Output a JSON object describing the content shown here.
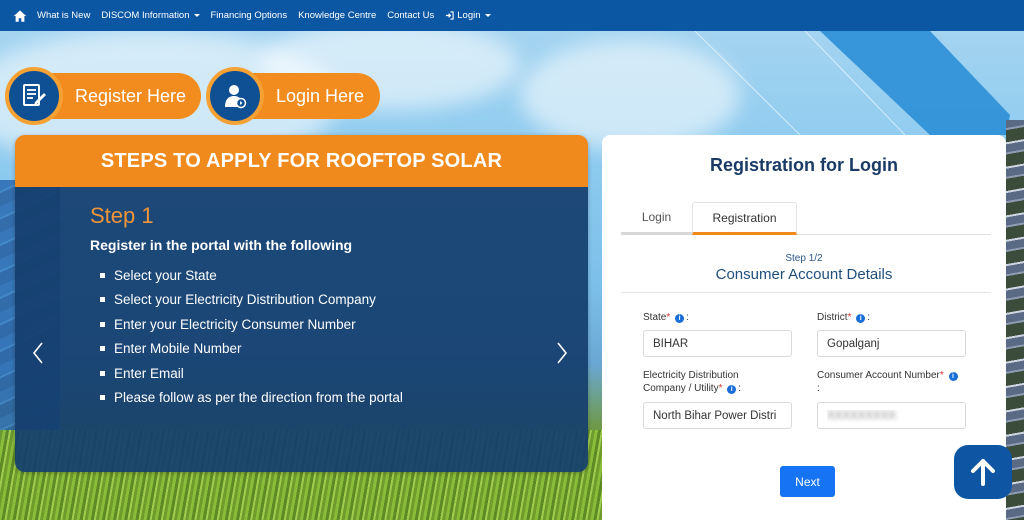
{
  "nav": {
    "home_icon": "home-icon",
    "items": [
      {
        "label": "What is New",
        "dropdown": false
      },
      {
        "label": "DISCOM Information",
        "dropdown": true
      },
      {
        "label": "Financing Options",
        "dropdown": false
      },
      {
        "label": "Knowledge Centre",
        "dropdown": false
      },
      {
        "label": "Contact Us",
        "dropdown": false
      },
      {
        "label": "Login",
        "dropdown": true,
        "icon": "sign-in-icon"
      }
    ]
  },
  "actions": {
    "register": {
      "label": "Register Here",
      "icon": "document-pen-icon"
    },
    "login": {
      "label": "Login Here",
      "icon": "user-arrow-icon"
    }
  },
  "steps": {
    "heading": "STEPS TO APPLY FOR ROOFTOP SOLAR",
    "title": "Step 1",
    "subtitle": "Register in the portal with the following",
    "items": [
      "Select your State",
      "Select your Electricity Distribution Company",
      "Enter your Electricity Consumer Number",
      "Enter Mobile Number",
      "Enter Email",
      "Please follow as per the direction from the portal"
    ],
    "prev_icon": "chevron-left-icon",
    "next_icon": "chevron-right-icon",
    "slide_count": 6,
    "active_slide": 1
  },
  "registration": {
    "title": "Registration for Login",
    "tabs": [
      {
        "label": "Login",
        "active": false
      },
      {
        "label": "Registration",
        "active": true
      }
    ],
    "step_indicator": "Step 1/2",
    "section_title": "Consumer Account Details",
    "fields": {
      "state": {
        "label": "State",
        "required_mark": "*",
        "suffix": ":",
        "value": "BIHAR"
      },
      "district": {
        "label": "District",
        "required_mark": "*",
        "suffix": ":",
        "value": "Gopalganj"
      },
      "utility": {
        "label_line1": "Electricity Distribution",
        "label_line2": "Company / Utility",
        "required_mark": "*",
        "suffix": ":",
        "value": "North Bihar Power Distri"
      },
      "account": {
        "label": "Consumer Account Number",
        "required_mark": "*",
        "suffix": ":",
        "value": "XXXXXXXXX"
      }
    },
    "info_glyph": "i",
    "next_label": "Next"
  },
  "scroll_top": {
    "icon": "arrow-up-icon"
  },
  "colors": {
    "nav_bg": "#0b57a4",
    "accent_orange": "#f08a1c",
    "primary_blue": "#1673f3",
    "title_navy": "#1a3b66"
  }
}
